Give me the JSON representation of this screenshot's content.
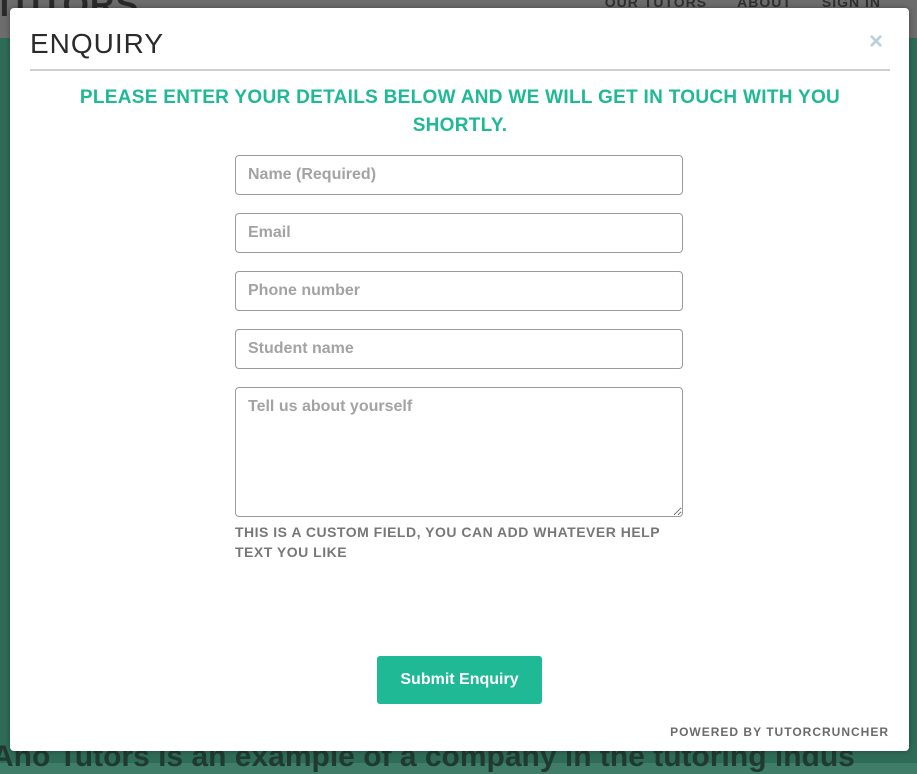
{
  "background": {
    "logo": "TUTORS",
    "nav": [
      "OUR TUTORS",
      "ABOUT",
      "SIGN IN"
    ],
    "body_text": "Aho Tutors is an example of a company in the tutoring indus"
  },
  "modal": {
    "title": "ENQUIRY",
    "close_icon": "×",
    "intro": "PLEASE ENTER YOUR DETAILS BELOW AND WE WILL GET IN TOUCH WITH YOU SHORTLY.",
    "fields": {
      "name_placeholder": "Name (Required)",
      "email_placeholder": "Email",
      "phone_placeholder": "Phone number",
      "student_placeholder": "Student name",
      "about_placeholder": "Tell us about yourself"
    },
    "help_text": "THIS IS A CUSTOM FIELD, YOU CAN ADD WHATEVER HELP TEXT YOU LIKE",
    "submit_label": "Submit Enquiry",
    "powered_by": "POWERED BY TUTORCRUNCHER"
  },
  "colors": {
    "accent": "#1fb996",
    "overlay_bg": "#2f6c57"
  }
}
